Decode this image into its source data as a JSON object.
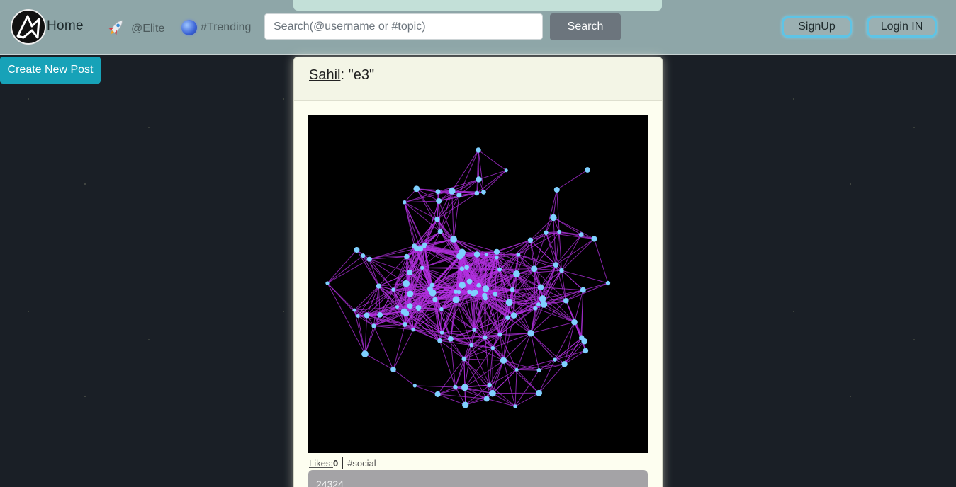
{
  "navbar": {
    "home_label": "Home",
    "elite_label": "@Elite",
    "trending_label": "#Trending",
    "search": {
      "placeholder": "Search(@username or #topic)",
      "value": "",
      "button_label": "Search"
    },
    "signup_label": "SignUp",
    "login_label": "Login IN"
  },
  "sidebar": {
    "create_post_label": "Create New Post"
  },
  "post": {
    "author": "Sahil",
    "separator": ": ",
    "title": "\"e3\"",
    "likes_label": "Likes:",
    "likes_count": "0",
    "hashtag": "#social",
    "comment_preview": "24324"
  },
  "icons": {
    "brand": "brand-logo-icon",
    "elite": "rocket-icon",
    "trending": "globe-icon"
  },
  "colors": {
    "navbar_bg": "#8ea6a8",
    "search_button": "#6c757d",
    "create_post_button": "#17a2b8",
    "auth_border": "#5ec4e6",
    "card_bg": "#fdfef0",
    "page_bg": "#1a1f26"
  }
}
